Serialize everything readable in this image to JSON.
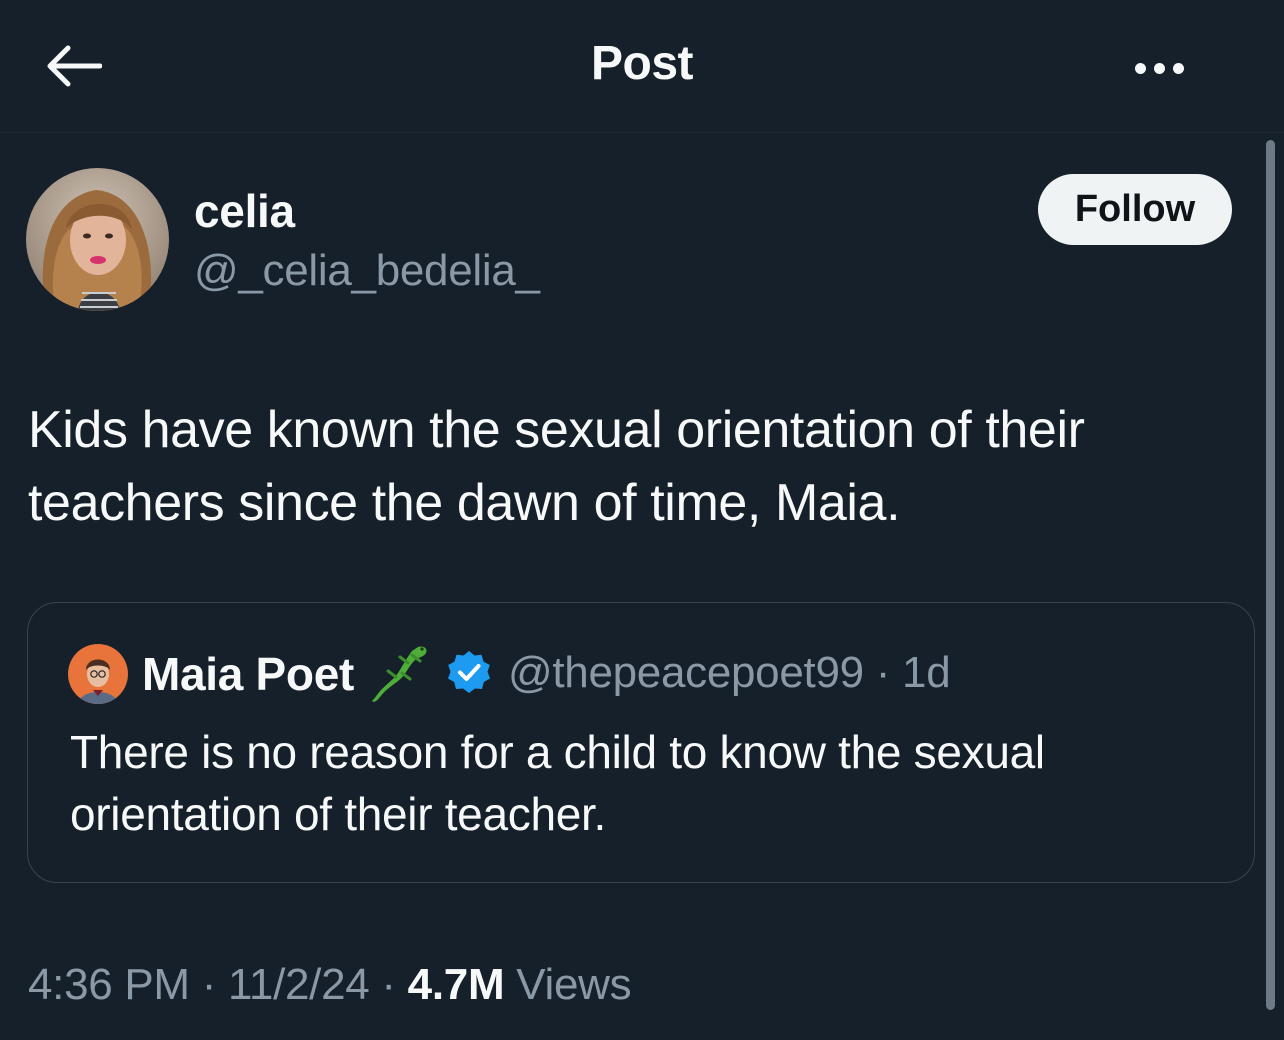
{
  "header": {
    "back_icon": "arrow-left-icon",
    "title": "Post",
    "more_icon": "more-horizontal-icon"
  },
  "post": {
    "author": {
      "display_name": "celia",
      "handle": "@_celia_bedelia_"
    },
    "follow_label": "Follow",
    "text": "Kids have known the sexual orientation of their\nteachers since the dawn of time, Maia.",
    "quoted": {
      "display_name": "Maia Poet",
      "name_emoji": "lizard-icon",
      "verified_icon": "verified-badge-icon",
      "handle": "@thepeacepoet99",
      "separator": "·",
      "age": "1d",
      "text": "There is no reason for a child to know the sexual\norientation of their teacher."
    },
    "meta": {
      "time": "4:36 PM",
      "sep1": "·",
      "date": "11/2/24",
      "sep2": "·",
      "views_count": "4.7M",
      "views_label": "Views"
    }
  },
  "colors": {
    "background": "#15202b",
    "text_primary": "#f7f9f9",
    "text_secondary": "#8b98a5",
    "border": "#38444d",
    "verified_blue": "#1d9bf0",
    "follow_bg": "#eff3f4"
  }
}
